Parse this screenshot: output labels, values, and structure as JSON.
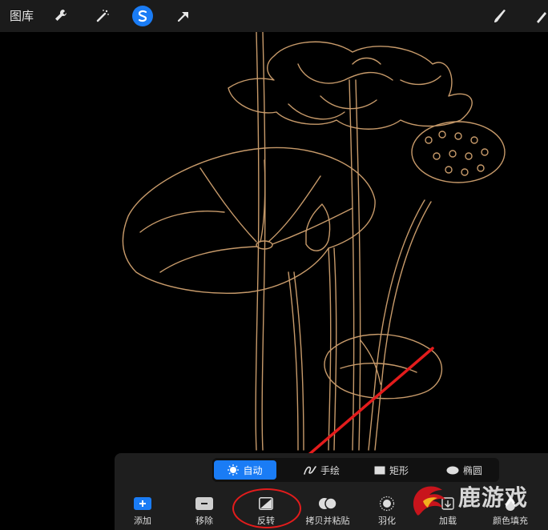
{
  "topbar": {
    "gallery_label": "图库",
    "tools": [
      {
        "icon": "wrench-icon"
      },
      {
        "icon": "magic-wand-icon"
      },
      {
        "icon": "selection-icon",
        "active": true
      },
      {
        "icon": "transform-arrow-icon"
      },
      {
        "icon": "brush-icon"
      },
      {
        "icon": "smudge-icon"
      }
    ]
  },
  "selection_panel": {
    "modes": [
      {
        "label": "自动",
        "icon": "auto-icon",
        "active": true
      },
      {
        "label": "手绘",
        "icon": "freehand-icon"
      },
      {
        "label": "矩形",
        "icon": "rectangle-icon"
      },
      {
        "label": "椭圆",
        "icon": "ellipse-icon"
      }
    ],
    "actions": [
      {
        "label": "添加",
        "icon": "add-icon"
      },
      {
        "label": "移除",
        "icon": "remove-icon"
      },
      {
        "label": "反转",
        "icon": "invert-icon"
      },
      {
        "label": "拷贝并粘贴",
        "icon": "copy-paste-icon"
      },
      {
        "label": "羽化",
        "icon": "feather-icon"
      },
      {
        "label": "加载",
        "icon": "load-icon"
      },
      {
        "label": "颜色填充",
        "icon": "color-fill-icon"
      }
    ]
  },
  "watermark": {
    "text": "鹿游戏"
  },
  "colors": {
    "accent": "#1a7cf5",
    "lineart": "#c79a6a",
    "annotation": "#e31c1c"
  }
}
